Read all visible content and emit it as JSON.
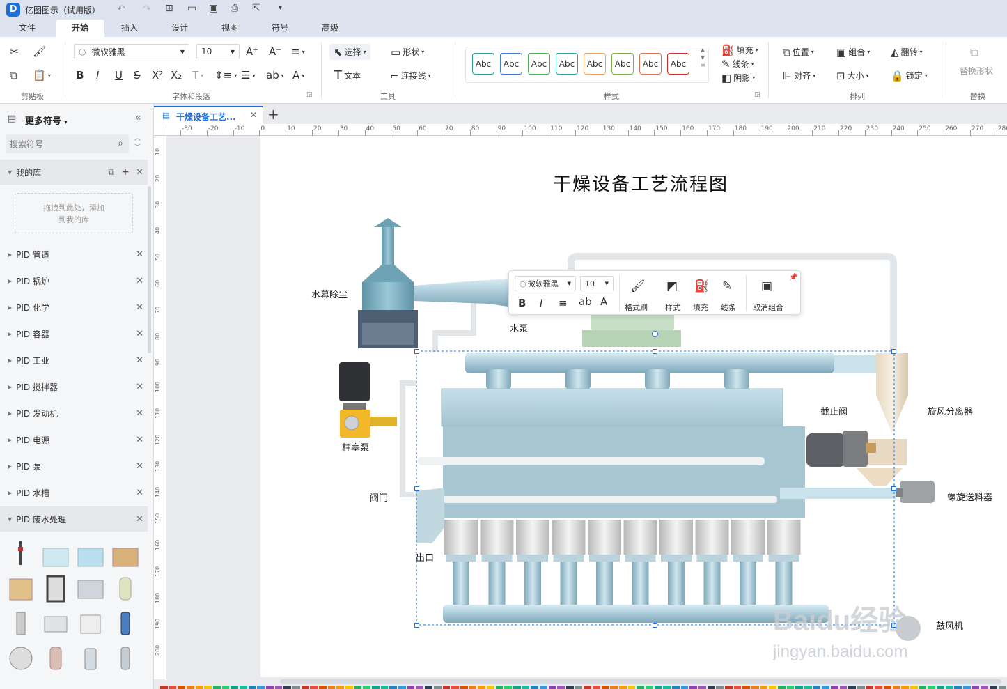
{
  "app": {
    "title": "亿图图示（试用版）"
  },
  "menu": {
    "tabs": [
      "文件",
      "开始",
      "插入",
      "设计",
      "视图",
      "符号",
      "高级"
    ],
    "active": "开始"
  },
  "ribbon": {
    "font_name": "微软雅黑",
    "font_size": "10",
    "select_label": "选择",
    "shape_label": "形状",
    "text_label": "文本",
    "connector_label": "连接线",
    "fill_label": "填充",
    "line_label": "线条",
    "shadow_label": "阴影",
    "position_label": "位置",
    "group_label": "组合",
    "flip_label": "翻转",
    "align_label": "对齐",
    "size_label": "大小",
    "lock_label": "锁定",
    "replace_label": "替换形状",
    "style_sample": "Abc",
    "style_colors": [
      "#2a9d8f",
      "#3a7bd5",
      "#4caf50",
      "#26a69a",
      "#f4a261",
      "#7cb342",
      "#e76f51",
      "#d62828"
    ],
    "groups": {
      "clipboard": "剪贴板",
      "font": "字体和段落",
      "tools": "工具",
      "styles": "样式",
      "arrange": "排列",
      "replace": "替换"
    }
  },
  "sidebar": {
    "header": "更多符号",
    "search_placeholder": "搜索符号",
    "mylib": "我的库",
    "mylib_hint": "拖拽到此处，添加到我的库",
    "libraries": [
      "PID 管道",
      "PID 锅炉",
      "PID 化学",
      "PID 容器",
      "PID 工业",
      "PID 搅拌器",
      "PID 发动机",
      "PID 电源",
      "PID 泵",
      "PID 水槽",
      "PID 废水处理"
    ]
  },
  "doc_tab": {
    "label": "干燥设备工艺..."
  },
  "ruler": {
    "top": [
      "-30",
      "-20",
      "-10",
      "0",
      "10",
      "20",
      "30",
      "40",
      "50",
      "60",
      "70",
      "80",
      "90",
      "100",
      "110",
      "120",
      "130",
      "140",
      "150",
      "160",
      "170",
      "180",
      "190",
      "200",
      "210",
      "220",
      "230",
      "240",
      "250",
      "260",
      "270",
      "280"
    ],
    "left": [
      "10",
      "20",
      "30",
      "40",
      "50",
      "60",
      "70",
      "80",
      "90",
      "100",
      "110",
      "120",
      "130",
      "140",
      "150",
      "160",
      "170",
      "180",
      "190",
      "200"
    ]
  },
  "diagram": {
    "title": "干燥设备工艺流程图",
    "labels": {
      "dust": "水幕除尘",
      "pump": "水泵",
      "plunger": "柱塞泵",
      "valve": "阀门",
      "outlet": "出口",
      "shutoff": "截止阀",
      "cyclone": "旋风分离器",
      "screw": "螺旋送料器",
      "fan": "鼓风机"
    }
  },
  "float_toolbar": {
    "font": "微软雅黑",
    "size": "10",
    "format_brush": "格式刷",
    "style": "样式",
    "fill": "填充",
    "line": "线条",
    "ungroup": "取消组合"
  },
  "watermark": {
    "line1": "Baidu经验",
    "line2": "jingyan.baidu.com"
  }
}
